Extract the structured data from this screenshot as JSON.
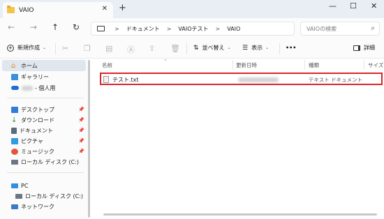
{
  "window": {
    "tab_title": "VAIO",
    "tab_close": "✕",
    "new_tab": "+",
    "minimize": "—",
    "maximize": "☐",
    "close": "✕"
  },
  "nav": {
    "back": "←",
    "forward": "→",
    "up": "↑",
    "refresh": "↻",
    "breadcrumb": [
      "ドキュメント",
      "VAIOテスト",
      "VAIO"
    ],
    "breadcrumb_sep": ">",
    "search_placeholder": "VAIOの検索"
  },
  "toolbar": {
    "new_label": "新規作成",
    "sort_label": "並べ替え",
    "view_label": "表示",
    "more_label": "•••",
    "details_label": "詳細"
  },
  "sidebar": {
    "home": "ホーム",
    "gallery": "ギャラリー",
    "onedrive": "- 個人用",
    "quick": [
      {
        "label": "デスクトップ",
        "color": "#2f7fd8"
      },
      {
        "label": "ダウンロード",
        "color": "#2c8a4a"
      },
      {
        "label": "ドキュメント",
        "color": "#5a6b7d"
      },
      {
        "label": "ピクチャ",
        "color": "#2f9be0"
      },
      {
        "label": "ミュージック",
        "color": "#e4563a"
      },
      {
        "label": "ローカル ディスク (C:)",
        "color": "#6b7783"
      }
    ],
    "pc": "PC",
    "pc_disk": "ローカル ディスク (C:)",
    "network": "ネットワーク"
  },
  "columns": {
    "name": "名前",
    "modified": "更新日時",
    "type": "種類",
    "size": "サイズ"
  },
  "files": [
    {
      "name": "テスト.txt",
      "type": "テキスト ドキュメント"
    }
  ]
}
